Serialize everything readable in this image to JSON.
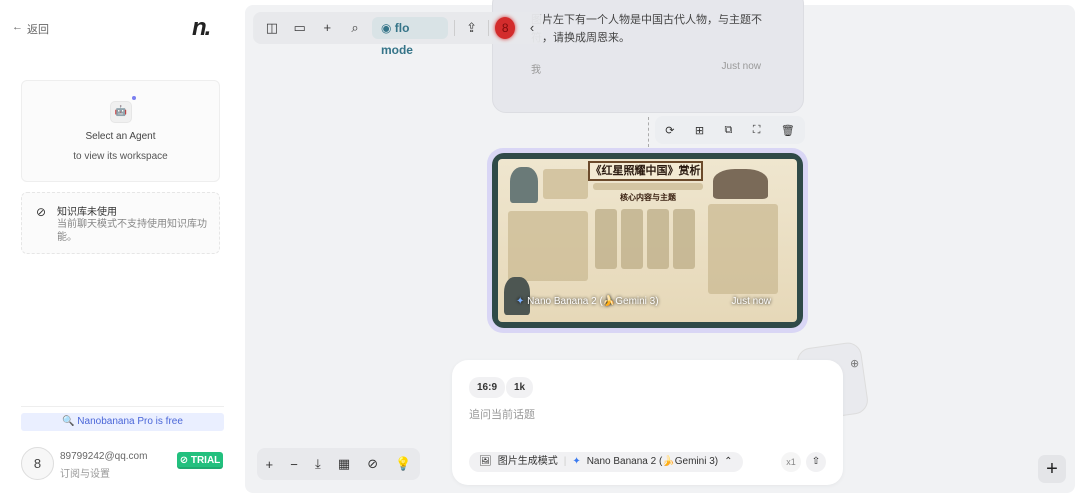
{
  "sidebar": {
    "back_label": "返回",
    "logo": "n.",
    "agent": {
      "title": "Select an Agent",
      "subtitle": "to view its workspace"
    },
    "kb": {
      "title": "知识库未使用",
      "desc": "当前聊天模式不支持使用知识库功能。"
    },
    "promo": "🔍 Nanobanana Pro is free",
    "user": {
      "avatar": "8",
      "email": "89799242@qq.com",
      "settings": "订阅与设置",
      "plan": "⊘ TRIAL"
    }
  },
  "toolbar": {
    "flo_mode": "flo mode",
    "badge": "8"
  },
  "message": {
    "text": "图片左下有一个人物是中国古代人物，与主题不符，请换成周恩来。",
    "sender": "我",
    "time": "Just now"
  },
  "image_card": {
    "poster_title": "《红星照耀中国》赏析",
    "poster_subtitle": "核心内容与主题",
    "model": "Nano Banana 2 (🍌Gemini 3)",
    "time": "Just now"
  },
  "composer": {
    "ratio": "16:9",
    "resolution": "1k",
    "placeholder": "追问当前话题",
    "mode": "图片生成模式",
    "model": "Nano Banana 2 (🍌Gemini 3)",
    "count": "x1"
  },
  "colors": {
    "accent": "#2b6e83",
    "trial": "#22c07e",
    "badge": "#d32222",
    "image_border": "#d9d6f5"
  }
}
